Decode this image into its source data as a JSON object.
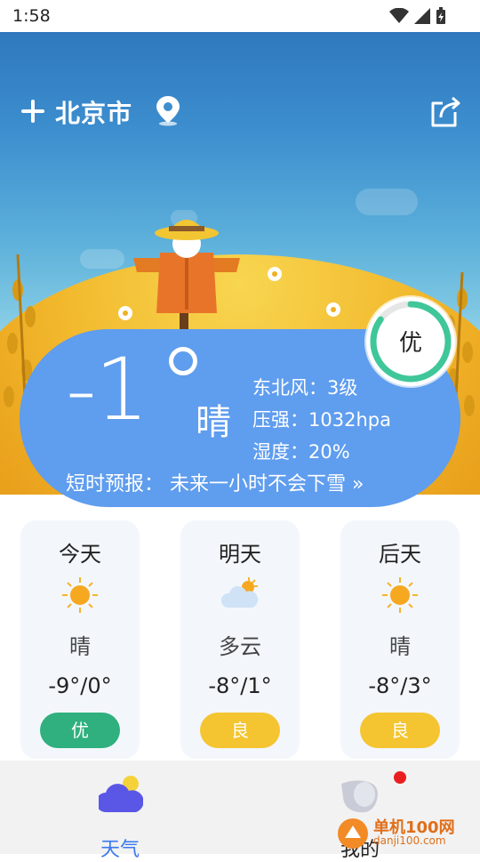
{
  "status": {
    "time": "1:58"
  },
  "header": {
    "city": "北京市"
  },
  "current": {
    "temp": "-1",
    "condition": "晴",
    "wind": "东北风：3级",
    "pressure": "压强：1032hpa",
    "humidity": "湿度：20%",
    "forecast": "短时预报： 未来一小时不会下雪 »"
  },
  "aqi": {
    "label": "优",
    "level_fraction": 0.85,
    "color": "#3fc79a"
  },
  "days": [
    {
      "name": "今天",
      "icon": "sun-icon",
      "cond": "晴",
      "temp": "-9°/0°",
      "aqi": "优",
      "aqi_color": "#2fb07e"
    },
    {
      "name": "明天",
      "icon": "cloud-sun-icon",
      "cond": "多云",
      "temp": "-8°/1°",
      "aqi": "良",
      "aqi_color": "#f4c531"
    },
    {
      "name": "后天",
      "icon": "sun-icon",
      "cond": "晴",
      "temp": "-8°/3°",
      "aqi": "良",
      "aqi_color": "#f4c531"
    }
  ],
  "nav": {
    "weather": "天气",
    "mine": "我的"
  },
  "watermark": {
    "main": "单机100网",
    "sub": "danji100.com"
  }
}
